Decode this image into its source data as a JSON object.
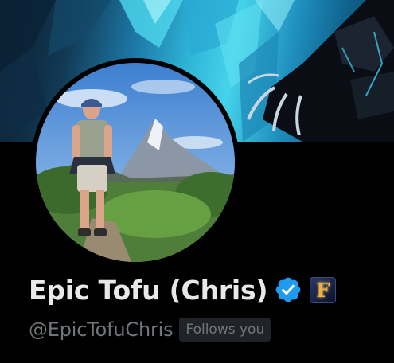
{
  "profile": {
    "display_name": "Epic Tofu (Chris)",
    "handle": "@EpicTofuChris",
    "follows_you_label": "Follows you",
    "affiliate_badge_letter": "F",
    "verified": true
  },
  "icons": {
    "verified": "verified-badge-icon",
    "affiliate": "fortnite-affiliate-icon"
  },
  "colors": {
    "background": "#000000",
    "name_text": "#e7e9ea",
    "handle_text": "#71767b",
    "verified_blue": "#1d9bf0",
    "follows_badge_bg": "#202327"
  }
}
